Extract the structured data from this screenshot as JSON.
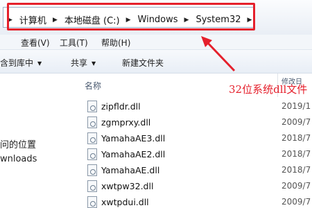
{
  "address_bar": {
    "breadcrumb": [
      "计算机",
      "本地磁盘 (C:)",
      "Windows",
      "System32"
    ]
  },
  "menu": {
    "items": [
      "查看(V)",
      "工具(T)",
      "帮助(H)"
    ]
  },
  "toolbar": {
    "include_in_library": "含到库中",
    "share": "共享",
    "new_folder": "新建文件夹"
  },
  "nav": {
    "items": [
      "问的位置",
      "wnloads"
    ]
  },
  "columns": {
    "name": "名称",
    "date": "修改日"
  },
  "annotation": {
    "text": "32位系统dll文件",
    "color": "#e5202c"
  },
  "files": [
    {
      "name": "zipfldr.dll",
      "date": "2019/1"
    },
    {
      "name": "zgmprxy.dll",
      "date": "2009/7"
    },
    {
      "name": "YamahaAE3.dll",
      "date": "2018/7"
    },
    {
      "name": "YamahaAE2.dll",
      "date": "2018/7"
    },
    {
      "name": "YamahaAE.dll",
      "date": "2018/7"
    },
    {
      "name": "xwtpw32.dll",
      "date": "2009/7"
    },
    {
      "name": "xwtpdui.dll",
      "date": "2009/7"
    }
  ]
}
